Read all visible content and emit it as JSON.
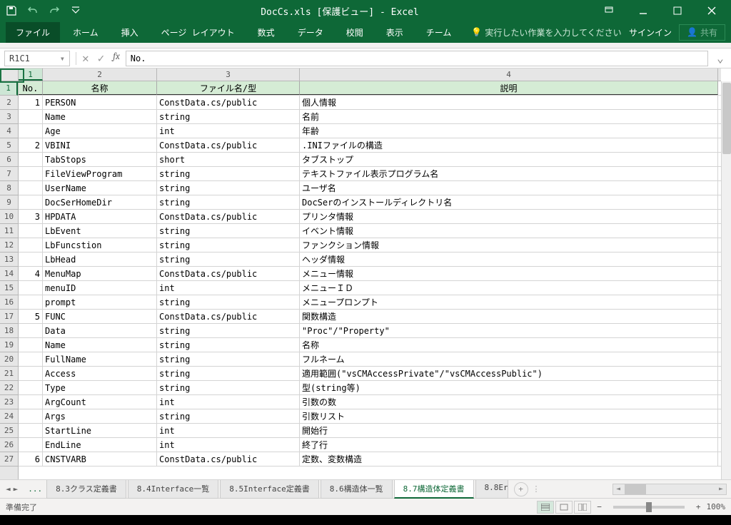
{
  "title": "DocCs.xls  [保護ビュー] - Excel",
  "qat": [
    "save",
    "undo",
    "redo",
    "customize"
  ],
  "win": [
    "restore-small",
    "minimize",
    "maximize",
    "close"
  ],
  "ribbon": {
    "tabs": [
      "ファイル",
      "ホーム",
      "挿入",
      "ページ レイアウト",
      "数式",
      "データ",
      "校閲",
      "表示",
      "チーム"
    ],
    "tell": "実行したい作業を入力してください",
    "signin": "サインイン",
    "share": "共有"
  },
  "namebox": "R1C1",
  "formula": "No.",
  "col_headers": [
    "1",
    "2",
    "3",
    "4"
  ],
  "row_headers": [
    "1",
    "2",
    "3",
    "4",
    "5",
    "6",
    "7",
    "8",
    "9",
    "10",
    "11",
    "12",
    "13",
    "14",
    "15",
    "16",
    "17",
    "18",
    "19",
    "20",
    "21",
    "22",
    "23",
    "24",
    "25",
    "26",
    "27"
  ],
  "header_row": {
    "no": "No.",
    "name": "名称",
    "file": "ファイル名/型",
    "desc": "説明"
  },
  "rows": [
    {
      "no": "1",
      "name": "PERSON",
      "file": "ConstData.cs/public",
      "desc": "個人情報"
    },
    {
      "no": "",
      "name": "Name",
      "file": "string",
      "desc": "名前"
    },
    {
      "no": "",
      "name": "Age",
      "file": "int",
      "desc": "年齢"
    },
    {
      "no": "2",
      "name": "VBINI",
      "file": "ConstData.cs/public",
      "desc": ".INIファイルの構造"
    },
    {
      "no": "",
      "name": "TabStops",
      "file": "short",
      "desc": "タブストップ"
    },
    {
      "no": "",
      "name": "FileViewProgram",
      "file": "string",
      "desc": "テキストファイル表示プログラム名"
    },
    {
      "no": "",
      "name": "UserName",
      "file": "string",
      "desc": "ユーザ名"
    },
    {
      "no": "",
      "name": "DocSerHomeDir",
      "file": "string",
      "desc": "DocSerのインストールディレクトリ名"
    },
    {
      "no": "3",
      "name": "HPDATA",
      "file": "ConstData.cs/public",
      "desc": "プリンタ情報"
    },
    {
      "no": "",
      "name": "LbEvent",
      "file": "string",
      "desc": "イベント情報"
    },
    {
      "no": "",
      "name": "LbFuncstion",
      "file": "string",
      "desc": "ファンクション情報"
    },
    {
      "no": "",
      "name": "LbHead",
      "file": "string",
      "desc": "ヘッダ情報"
    },
    {
      "no": "4",
      "name": "MenuMap",
      "file": "ConstData.cs/public",
      "desc": "メニュー情報"
    },
    {
      "no": "",
      "name": "menuID",
      "file": "int",
      "desc": "メニューＩＤ"
    },
    {
      "no": "",
      "name": "prompt",
      "file": "string",
      "desc": "メニュープロンプト"
    },
    {
      "no": "5",
      "name": "FUNC",
      "file": "ConstData.cs/public",
      "desc": "関数構造"
    },
    {
      "no": "",
      "name": "Data",
      "file": "string",
      "desc": "\"Proc\"/\"Property\""
    },
    {
      "no": "",
      "name": "Name",
      "file": "string",
      "desc": "名称"
    },
    {
      "no": "",
      "name": "FullName",
      "file": "string",
      "desc": "フルネーム"
    },
    {
      "no": "",
      "name": "Access",
      "file": "string",
      "desc": "適用範囲(\"vsCMAccessPrivate\"/\"vsCMAccessPublic\")"
    },
    {
      "no": "",
      "name": "Type",
      "file": "string",
      "desc": "型(string等)"
    },
    {
      "no": "",
      "name": "ArgCount",
      "file": "int",
      "desc": "引数の数"
    },
    {
      "no": "",
      "name": "Args",
      "file": "string",
      "desc": "引数リスト"
    },
    {
      "no": "",
      "name": "StartLine",
      "file": "int",
      "desc": "開始行"
    },
    {
      "no": "",
      "name": "EndLine",
      "file": "int",
      "desc": "終了行"
    },
    {
      "no": "6",
      "name": "CNSTVARB",
      "file": "ConstData.cs/public",
      "desc": "定数、変数構造"
    }
  ],
  "sheets": {
    "tabs": [
      "8.3クラス定義書",
      "8.4Interface一覧",
      "8.5Interface定義書",
      "8.6構造体一覧",
      "8.7構造体定義書",
      "8.8Er"
    ],
    "active": 4
  },
  "status": {
    "ready": "準備完了",
    "zoom": "100%"
  }
}
